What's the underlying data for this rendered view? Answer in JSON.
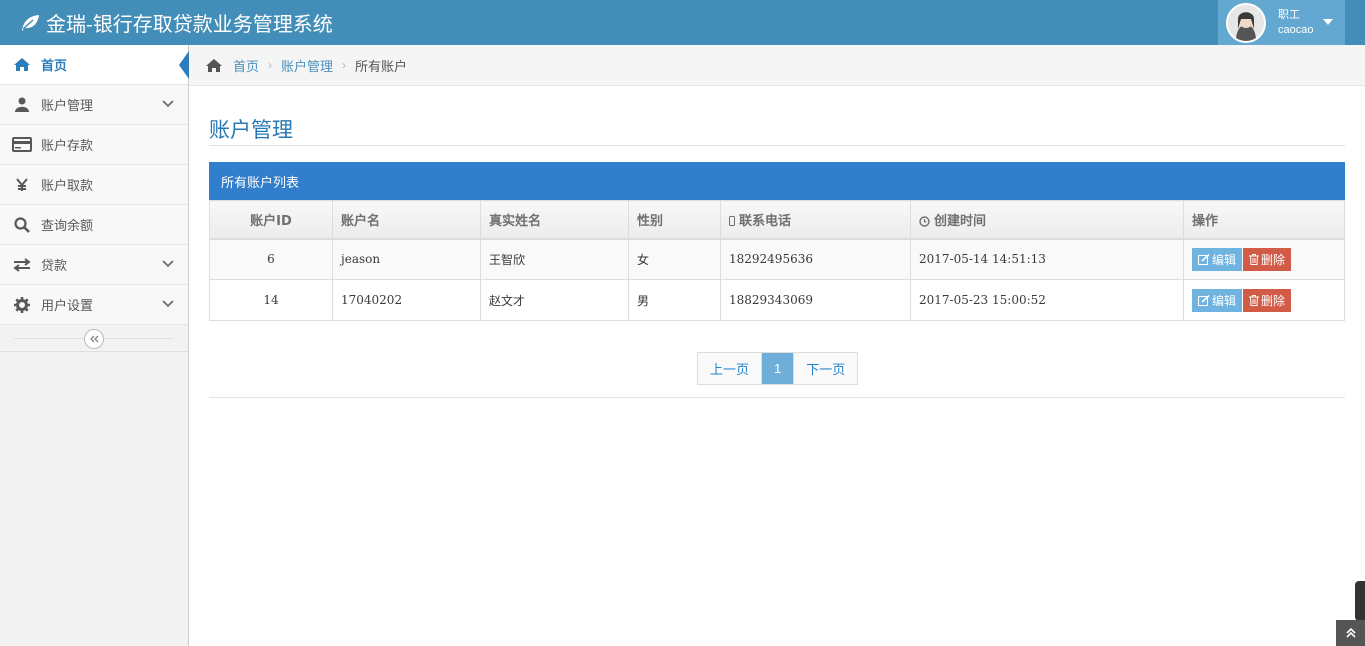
{
  "app": {
    "title": "金瑞-银行存取贷款业务管理系统"
  },
  "user": {
    "role": "职工",
    "name": "caocao"
  },
  "sidebar": {
    "items": [
      {
        "label": "首页",
        "icon": "home-icon",
        "active": true
      },
      {
        "label": "账户管理",
        "icon": "user-icon",
        "expandable": true
      },
      {
        "label": "账户存款",
        "icon": "credit-card-icon"
      },
      {
        "label": "账户取款",
        "icon": "yen-icon"
      },
      {
        "label": "查询余额",
        "icon": "search-icon"
      },
      {
        "label": "贷款",
        "icon": "exchange-icon",
        "expandable": true
      },
      {
        "label": "用户设置",
        "icon": "gear-icon",
        "expandable": true
      }
    ]
  },
  "breadcrumb": {
    "home": "首页",
    "parent": "账户管理",
    "current": "所有账户"
  },
  "page": {
    "title": "账户管理"
  },
  "table": {
    "caption": "所有账户列表",
    "columns": [
      "账户ID",
      "账户名",
      "真实姓名",
      "性别",
      "联系电话",
      "创建时间",
      "操作"
    ],
    "rows": [
      {
        "id": "6",
        "account": "jeason",
        "real_name": "王智欣",
        "gender": "女",
        "phone": "18292495636",
        "created": "2017-05-14 14:51:13"
      },
      {
        "id": "14",
        "account": "17040202",
        "real_name": "赵文才",
        "gender": "男",
        "phone": "18829343069",
        "created": "2017-05-23 15:00:52"
      }
    ],
    "edit_label": "编辑",
    "delete_label": "删除"
  },
  "pagination": {
    "prev": "上一页",
    "current": "1",
    "next": "下一页"
  },
  "colors": {
    "navbar": "#438eb9",
    "accent": "#307ecc",
    "edit": "#6fb3e0",
    "delete": "#d15b47"
  }
}
